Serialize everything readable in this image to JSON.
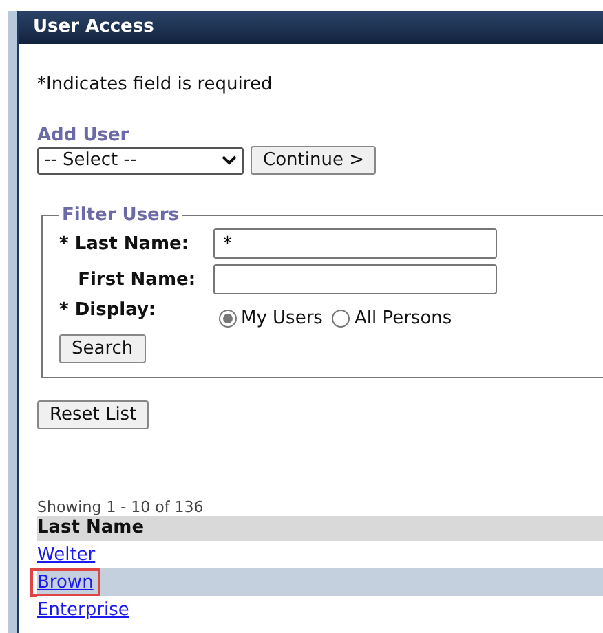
{
  "window": {
    "title": "User Access"
  },
  "required_note": "*Indicates field is required",
  "add_user": {
    "heading": "Add User",
    "select": {
      "value": "-- Select --"
    },
    "button": "Continue >"
  },
  "filter": {
    "legend": "Filter Users",
    "fields": [
      {
        "required_mark": "*",
        "label": "Last Name:",
        "value": "*"
      },
      {
        "label": "First Name:"
      }
    ],
    "display": {
      "required_mark": "*",
      "label": "Display:",
      "options": [
        {
          "label": "My Users",
          "selected": true
        },
        {
          "label": "All Persons",
          "selected": false
        }
      ]
    },
    "button": "Search"
  },
  "reset_button": "Reset List",
  "table": {
    "summary": "Showing 1 - 10 of 136",
    "columns": [
      "Last Name"
    ],
    "rows": [
      {
        "last_name": "Welter",
        "selected": false,
        "outlined": false
      },
      {
        "last_name": "Brown",
        "selected": true,
        "outlined": true
      },
      {
        "last_name": "Enterprise",
        "selected": false,
        "outlined": false
      }
    ]
  }
}
